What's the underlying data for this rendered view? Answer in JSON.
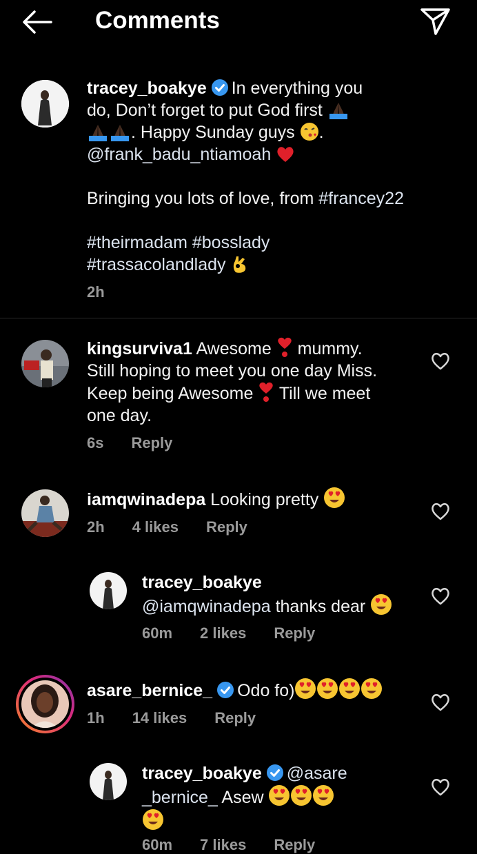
{
  "header": {
    "title": "Comments"
  },
  "caption": {
    "username": "tracey_boakye",
    "text_1": "In everything you",
    "text_2": "do, Don’t forget to put God first",
    "text_3": ". Happy Sunday guys",
    "text_3_end": ".",
    "mention": "@frank_badu_ntiamoah",
    "line_love": "Bringing you lots of love, from",
    "tag_francey": "#francey22",
    "tag_theirmadam": "#theirmadam",
    "tag_bosslady": "#bosslady",
    "tag_trassaco": "#trassacolandlady",
    "time": "2h"
  },
  "comments": [
    {
      "username": "kingsurviva1",
      "line1a": "Awesome",
      "line1b": "mummy.",
      "line2": "Still hoping to meet you one day Miss.",
      "line3a": "Keep being Awesome",
      "line3b": "Till we meet",
      "line4": "one day.",
      "time": "6s",
      "reply_label": "Reply"
    },
    {
      "username": "iamqwinadepa",
      "text": "Looking pretty",
      "time": "2h",
      "likes": "4 likes",
      "reply_label": "Reply"
    },
    {
      "username": "tracey_boakye",
      "mention": "@iamqwinadepa",
      "text": "thanks dear",
      "time": "60m",
      "likes": "2 likes",
      "reply_label": "Reply"
    },
    {
      "username": "asare_bernice_",
      "text": "Odo fo)",
      "time": "1h",
      "likes": "14 likes",
      "reply_label": "Reply"
    },
    {
      "username": "tracey_boakye",
      "mention_a": "@asare",
      "mention_b": "_bernice_",
      "text": "Asew",
      "time": "60m",
      "likes": "7 likes",
      "reply_label": "Reply"
    }
  ],
  "colors": {
    "background": "#000000",
    "verified": "#3897f0",
    "heart": "#e0202a",
    "story_ring_a": "#f58529",
    "story_ring_b": "#dd2a7b"
  }
}
